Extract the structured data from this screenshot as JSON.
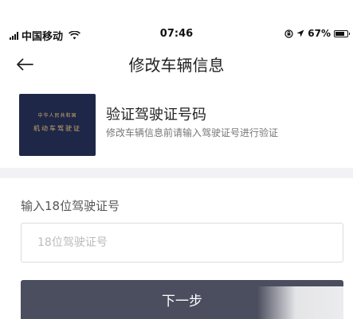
{
  "status_bar": {
    "carrier": "中国移动",
    "time": "07:46",
    "battery": "67%",
    "battery_level": 0.67,
    "icons": [
      "signal-icon",
      "wifi-icon",
      "lock-rotation-icon",
      "location-icon",
      "battery-icon"
    ]
  },
  "nav": {
    "back_icon": "back-arrow-icon",
    "title": "修改车辆信息"
  },
  "verify": {
    "license_line1": "中华人民共和国",
    "license_line2": "机动车驾驶证",
    "title": "验证驾驶证号码",
    "description": "修改车辆信息前请输入驾驶证号进行验证"
  },
  "form": {
    "label": "输入18位驾驶证号",
    "value": "",
    "placeholder": "18位驾驶证号"
  },
  "actions": {
    "next_label": "下一步"
  },
  "colors": {
    "button_bg": "#4b4e5f",
    "license_bg": "#1f2748",
    "divider_bg": "#f2f2f5"
  }
}
